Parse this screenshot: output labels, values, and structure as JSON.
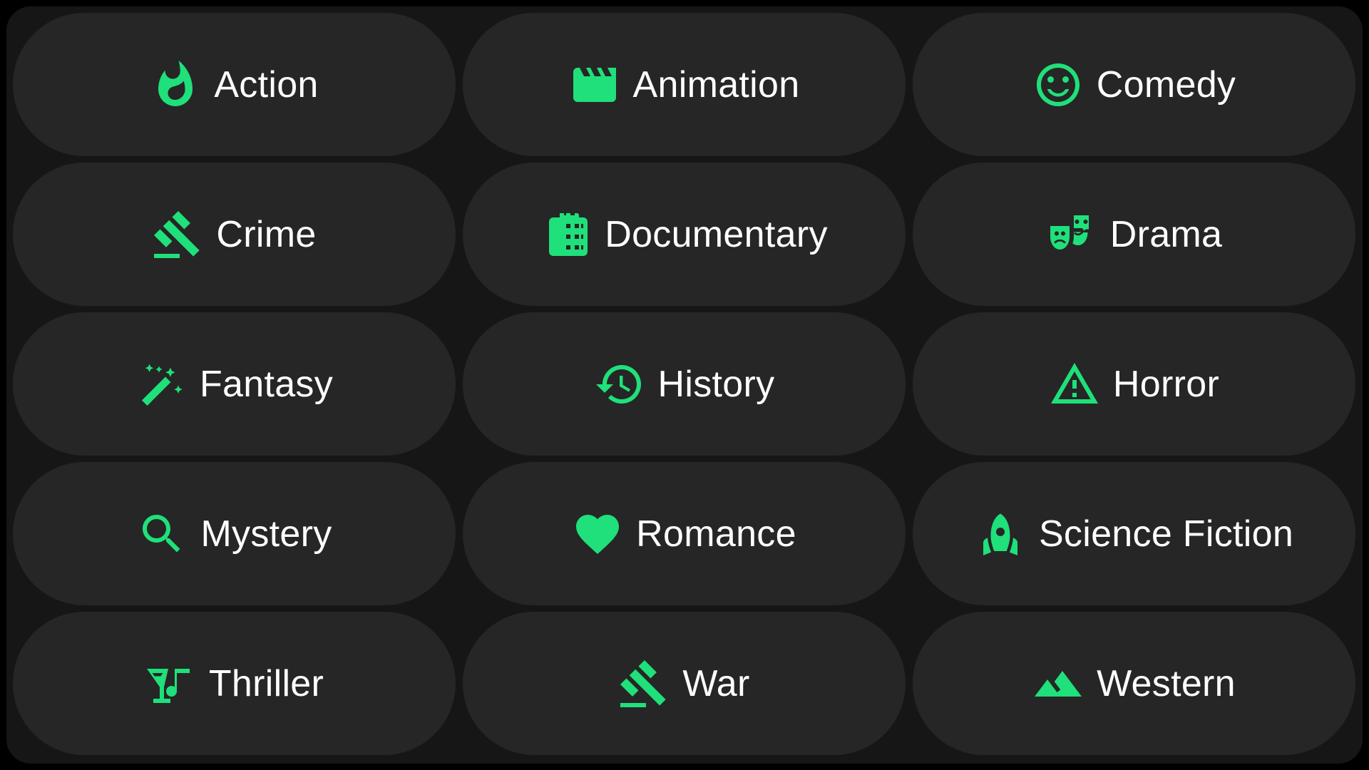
{
  "colors": {
    "accent": "#1fe07a",
    "pill_background": "#262626",
    "panel_background": "#161616",
    "text": "#ffffff"
  },
  "genres": [
    {
      "label": "Action",
      "icon": "flame-icon"
    },
    {
      "label": "Animation",
      "icon": "clapperboard-icon"
    },
    {
      "label": "Comedy",
      "icon": "smiley-face-icon"
    },
    {
      "label": "Crime",
      "icon": "gavel-icon"
    },
    {
      "label": "Documentary",
      "icon": "film-camera-icon"
    },
    {
      "label": "Drama",
      "icon": "theater-masks-icon"
    },
    {
      "label": "Fantasy",
      "icon": "magic-wand-icon"
    },
    {
      "label": "History",
      "icon": "history-clock-icon"
    },
    {
      "label": "Horror",
      "icon": "warning-triangle-icon"
    },
    {
      "label": "Mystery",
      "icon": "search-icon"
    },
    {
      "label": "Romance",
      "icon": "heart-icon"
    },
    {
      "label": "Science Fiction",
      "icon": "rocket-icon"
    },
    {
      "label": "Thriller",
      "icon": "cocktail-music-icon"
    },
    {
      "label": "War",
      "icon": "gavel-icon"
    },
    {
      "label": "Western",
      "icon": "mountains-icon"
    }
  ]
}
